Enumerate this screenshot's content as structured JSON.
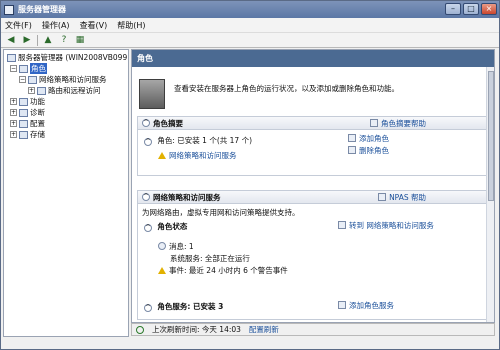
{
  "window": {
    "title": "服务器管理器"
  },
  "menu": [
    "文件(F)",
    "操作(A)",
    "查看(V)",
    "帮助(H)"
  ],
  "tree": {
    "root": "服务器管理器 (WIN2008VB0991)",
    "items": [
      {
        "label": "角色",
        "level": 1,
        "selected": true
      },
      {
        "label": "网络策略和访问服务",
        "level": 2
      },
      {
        "label": "路由和远程访问",
        "level": 3
      },
      {
        "label": "功能",
        "level": 1
      },
      {
        "label": "诊断",
        "level": 1
      },
      {
        "label": "配置",
        "level": 1
      },
      {
        "label": "存储",
        "level": 1
      }
    ]
  },
  "main": {
    "header": "角色",
    "intro_text": "查看安装在服务器上角色的运行状况，以及添加或删除角色和功能。",
    "summary": {
      "title": "角色摘要",
      "help_link": "角色摘要帮助",
      "roles_count": "角色: 已安装 1 个(共 17 个)",
      "role_item": "网络策略和访问服务",
      "add_roles": "添加角色",
      "remove_roles": "删除角色"
    },
    "npas": {
      "title": "网络策略和访问服务",
      "help_link": "NPAS 帮助",
      "desc": "为网络路由，虚拟专用网和访问策略提供支持。",
      "status_title": "角色状态",
      "goto_link": "转到 网络策略和访问服务",
      "messages": "消息: 1",
      "system_services": "系统服务: 全部正在运行",
      "events": "事件: 最近 24 小时内 6 个警告事件",
      "role_services": "角色服务: 已安装 3",
      "add_role_services": "添加角色服务"
    }
  },
  "status_bar": {
    "refresh_label": "上次刷新时间: 今天 14:03",
    "config_link": "配置刷新"
  }
}
